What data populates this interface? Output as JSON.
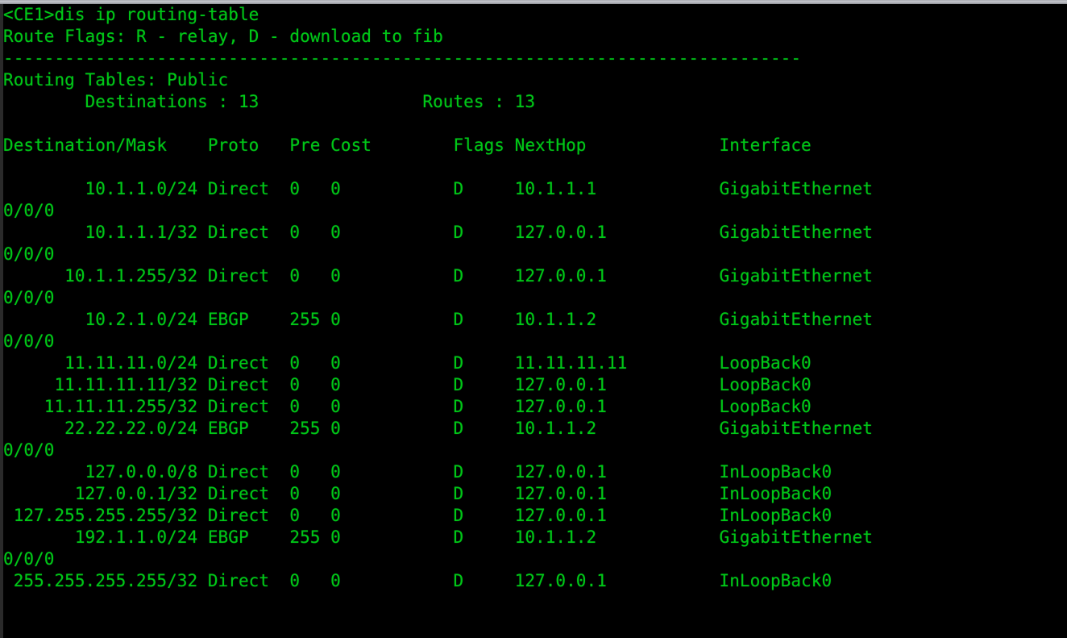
{
  "terminal": {
    "prompt": "<CE1>",
    "command": "dis ip routing-table",
    "foreground_color": "#00c717",
    "background_color": "#000000",
    "title_bar_color": "#b4b6bc",
    "route_flags_legend": "Route Flags: R - relay, D - download to fib",
    "separator": "------------------------------------------------------------------------------",
    "routing_tables_label": "Routing Tables: Public",
    "destinations_label": "Destinations",
    "destinations_count": "13",
    "routes_label": "Routes",
    "routes_count": "13",
    "columns": {
      "destination_mask": "Destination/Mask",
      "proto": "Proto",
      "pre": "Pre",
      "cost": "Cost",
      "flags": "Flags",
      "nexthop": "NextHop",
      "interface": "Interface"
    },
    "routes": [
      {
        "destination": "10.1.1.0/24",
        "proto": "Direct",
        "pre": "0",
        "cost": "0",
        "flags": "D",
        "nexthop": "10.1.1.1",
        "interface": "GigabitEthernet",
        "interface_wrap": "0/0/0"
      },
      {
        "destination": "10.1.1.1/32",
        "proto": "Direct",
        "pre": "0",
        "cost": "0",
        "flags": "D",
        "nexthop": "127.0.0.1",
        "interface": "GigabitEthernet",
        "interface_wrap": "0/0/0"
      },
      {
        "destination": "10.1.1.255/32",
        "proto": "Direct",
        "pre": "0",
        "cost": "0",
        "flags": "D",
        "nexthop": "127.0.0.1",
        "interface": "GigabitEthernet",
        "interface_wrap": "0/0/0"
      },
      {
        "destination": "10.2.1.0/24",
        "proto": "EBGP",
        "pre": "255",
        "cost": "0",
        "flags": "D",
        "nexthop": "10.1.1.2",
        "interface": "GigabitEthernet",
        "interface_wrap": "0/0/0"
      },
      {
        "destination": "11.11.11.0/24",
        "proto": "Direct",
        "pre": "0",
        "cost": "0",
        "flags": "D",
        "nexthop": "11.11.11.11",
        "interface": "LoopBack0",
        "interface_wrap": ""
      },
      {
        "destination": "11.11.11.11/32",
        "proto": "Direct",
        "pre": "0",
        "cost": "0",
        "flags": "D",
        "nexthop": "127.0.0.1",
        "interface": "LoopBack0",
        "interface_wrap": ""
      },
      {
        "destination": "11.11.11.255/32",
        "proto": "Direct",
        "pre": "0",
        "cost": "0",
        "flags": "D",
        "nexthop": "127.0.0.1",
        "interface": "LoopBack0",
        "interface_wrap": ""
      },
      {
        "destination": "22.22.22.0/24",
        "proto": "EBGP",
        "pre": "255",
        "cost": "0",
        "flags": "D",
        "nexthop": "10.1.1.2",
        "interface": "GigabitEthernet",
        "interface_wrap": "0/0/0"
      },
      {
        "destination": "127.0.0.0/8",
        "proto": "Direct",
        "pre": "0",
        "cost": "0",
        "flags": "D",
        "nexthop": "127.0.0.1",
        "interface": "InLoopBack0",
        "interface_wrap": ""
      },
      {
        "destination": "127.0.0.1/32",
        "proto": "Direct",
        "pre": "0",
        "cost": "0",
        "flags": "D",
        "nexthop": "127.0.0.1",
        "interface": "InLoopBack0",
        "interface_wrap": ""
      },
      {
        "destination": "127.255.255.255/32",
        "proto": "Direct",
        "pre": "0",
        "cost": "0",
        "flags": "D",
        "nexthop": "127.0.0.1",
        "interface": "InLoopBack0",
        "interface_wrap": ""
      },
      {
        "destination": "192.1.1.0/24",
        "proto": "EBGP",
        "pre": "255",
        "cost": "0",
        "flags": "D",
        "nexthop": "10.1.1.2",
        "interface": "GigabitEthernet",
        "interface_wrap": "0/0/0"
      },
      {
        "destination": "255.255.255.255/32",
        "proto": "Direct",
        "pre": "0",
        "cost": "0",
        "flags": "D",
        "nexthop": "127.0.0.1",
        "interface": "InLoopBack0",
        "interface_wrap": ""
      }
    ]
  }
}
